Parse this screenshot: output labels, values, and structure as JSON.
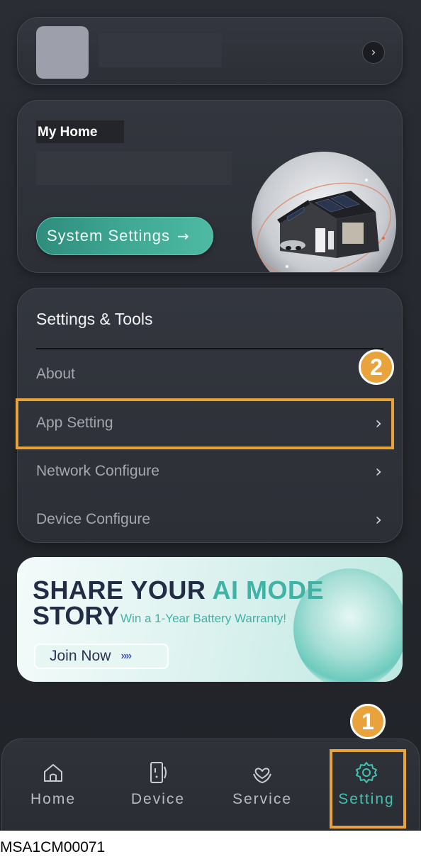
{
  "profile": {
    "chevron_icon": "chevron-right-icon"
  },
  "home": {
    "title": "My Home",
    "system_settings_label": "System Settings",
    "system_settings_arrow": "→"
  },
  "tools": {
    "title": "Settings & Tools",
    "items": [
      {
        "label": "About",
        "chevron": ""
      },
      {
        "label": "App Setting",
        "chevron": "›"
      },
      {
        "label": "Network Configure",
        "chevron": "›"
      },
      {
        "label": "Device Configure",
        "chevron": "›"
      }
    ]
  },
  "promo": {
    "line1_prefix": "SHARE YOUR ",
    "line1_highlight": "AI MODE",
    "line2": "STORY",
    "subtitle": "Win a 1-Year Battery Warranty!",
    "button_label": "Join Now",
    "button_chevrons": "»»"
  },
  "annotations": {
    "step1": "1",
    "step2": "2",
    "highlight_color": "#e8a33d"
  },
  "bottom_nav": {
    "items": [
      {
        "label": "Home",
        "icon": "home-icon",
        "active": false
      },
      {
        "label": "Device",
        "icon": "device-icon",
        "active": false
      },
      {
        "label": "Service",
        "icon": "service-icon",
        "active": false
      },
      {
        "label": "Setting",
        "icon": "gear-icon",
        "active": true
      }
    ],
    "active_color": "#3fc2b1"
  },
  "footer": {
    "code": "MSA1CM00071"
  }
}
